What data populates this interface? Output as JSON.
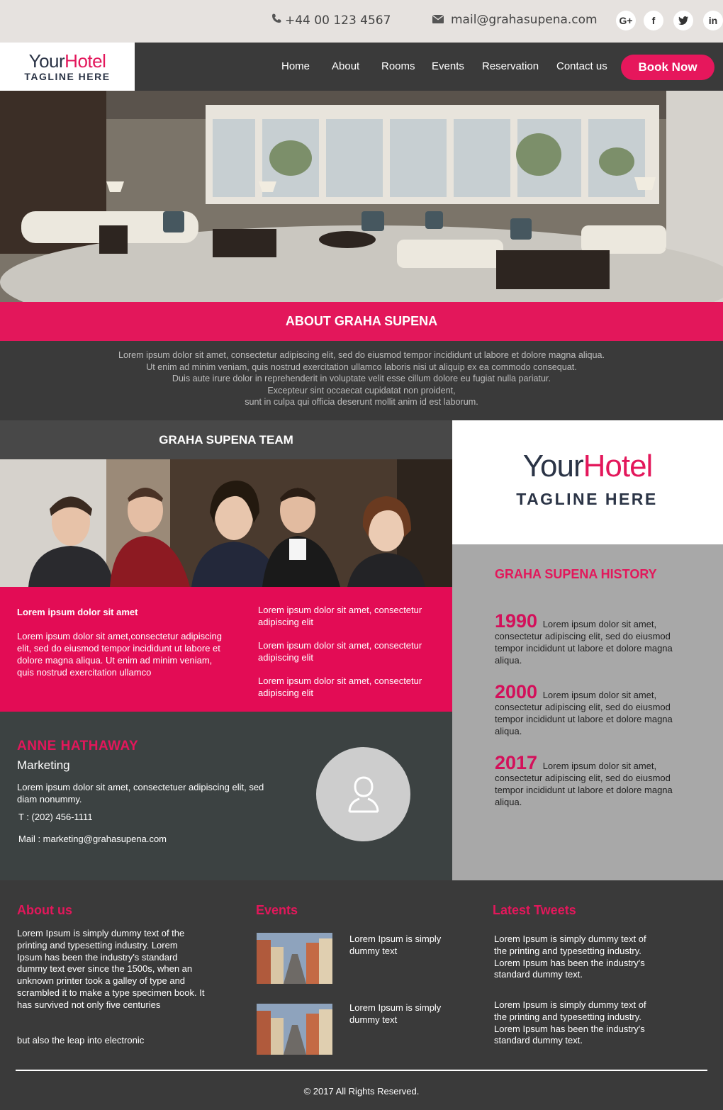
{
  "topbar": {
    "phone": "+44 00 123 4567",
    "email": "mail@grahasupena.com",
    "social": [
      {
        "icon": "google-plus-icon",
        "label": "G+"
      },
      {
        "icon": "facebook-icon",
        "label": "f"
      },
      {
        "icon": "twitter-icon",
        "label": "t"
      },
      {
        "icon": "linkedin-icon",
        "label": "in"
      }
    ]
  },
  "logo": {
    "your": "Your",
    "hotel": "Hotel",
    "tagline": "TAGLINE HERE"
  },
  "nav": {
    "items": [
      "Home",
      "About",
      "Rooms",
      "Events",
      "Reservation",
      "Contact us"
    ],
    "book_label": "Book Now"
  },
  "about": {
    "title": "ABOUT GRAHA SUPENA",
    "lines": [
      "Lorem ipsum dolor sit amet, consectetur adipiscing elit, sed do eiusmod tempor incididunt ut labore et dolore magna aliqua.",
      "Ut enim ad minim veniam, quis nostrud exercitation ullamco laboris nisi ut aliquip ex ea commodo consequat.",
      "Duis aute irure dolor in reprehenderit in voluptate velit esse cillum dolore eu fugiat nulla pariatur.",
      "Excepteur sint occaecat cupidatat non proident,",
      "sunt in culpa qui officia deserunt mollit anim id est laborum."
    ]
  },
  "team": {
    "title": "GRAHA SUPENA TEAM",
    "lead": "Lorem ipsum dolor sit amet",
    "body": "Lorem ipsum dolor sit amet,consectetur adipiscing elit, sed do eiusmod tempor incididunt ut labore et dolore magna aliqua. Ut enim ad minim veniam, quis nostrud exercitation ullamco",
    "list": [
      "Lorem ipsum dolor sit amet, consectetur adipiscing elit",
      "Lorem ipsum dolor sit amet, consectetur adipiscing elit",
      "Lorem ipsum dolor sit amet, consectetur adipiscing elit"
    ]
  },
  "person": {
    "name": "ANNE HATHAWAY",
    "role": "Marketing",
    "desc": "Lorem ipsum dolor sit amet, consectetuer adipiscing elit, sed diam nonummy.",
    "phone": "T : (202) 456-1111",
    "mail": "Mail : marketing@grahasupena.com"
  },
  "history": {
    "title": "GRAHA SUPENA HISTORY",
    "items": [
      {
        "year": "1990",
        "text": "Lorem ipsum dolor sit amet, consectetur adipiscing elit, sed do eiusmod tempor incididunt ut labore et dolore magna aliqua."
      },
      {
        "year": "2000",
        "text": "Lorem ipsum dolor sit amet, consectetur adipiscing elit, sed do eiusmod tempor incididunt ut labore et dolore magna aliqua."
      },
      {
        "year": "2017",
        "text": "Lorem ipsum dolor sit amet, consectetur adipiscing elit, sed do eiusmod tempor incididunt ut labore et dolore magna aliqua."
      }
    ]
  },
  "footer": {
    "about_title": "About us",
    "about_text": "Lorem Ipsum is simply dummy text of the printing and typesetting industry. Lorem Ipsum has been the industry's standard dummy text ever since the 1500s, when an unknown printer took a galley of type and scrambled it to make a type specimen book. It has survived not only five centuries",
    "about_text2": "but also the leap into electronic",
    "events_title": "Events",
    "events": [
      {
        "text": "Lorem Ipsum is simply dummy text"
      },
      {
        "text": "Lorem Ipsum is simply dummy text"
      }
    ],
    "tweets_title": "Latest Tweets",
    "tweets": [
      "Lorem Ipsum is simply dummy text of the printing and typesetting industry. Lorem Ipsum has been the industry's standard dummy text.",
      "Lorem Ipsum is simply dummy text of the printing and typesetting industry. Lorem Ipsum has been the industry's standard dummy text."
    ],
    "copyright": "© 2017 All Rights Reserved."
  },
  "colors": {
    "accent": "#e3175b",
    "dark": "#3a3a3a",
    "navy": "#2b3446"
  }
}
